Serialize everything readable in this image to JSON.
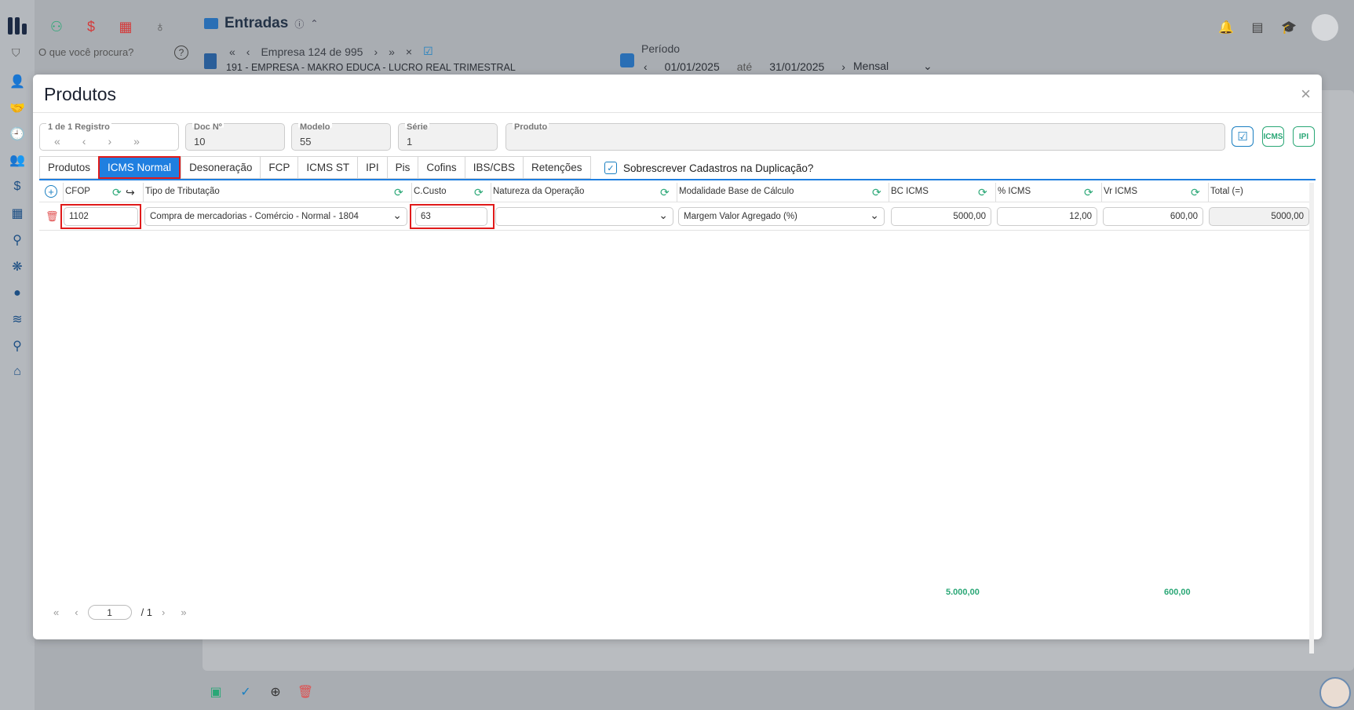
{
  "app": {
    "title": "Entradas",
    "search_placeholder": "O que você procura?",
    "empresa_nav": "Empresa 124 de 995",
    "empresa_name": "191 - EMPRESA - MAKRO EDUCA - LUCRO REAL TRIMESTRAL",
    "periodo_label": "Período",
    "date_from": "01/01/2025",
    "date_sep": "até",
    "date_to": "31/01/2025",
    "period_mode": "Mensal"
  },
  "modal": {
    "title": "Produtos",
    "close": "×",
    "record_label": "1 de 1 Registro",
    "fields": {
      "doc_label": "Doc Nº",
      "doc_value": "10",
      "modelo_label": "Modelo",
      "modelo_value": "55",
      "serie_label": "Série",
      "serie_value": "1",
      "produto_label": "Produto",
      "produto_value": ""
    },
    "actions": {
      "icms": "ICMS",
      "ipi": "IPI"
    },
    "tabs": [
      "Produtos",
      "ICMS Normal",
      "Desoneração",
      "FCP",
      "ICMS ST",
      "IPI",
      "Pis",
      "Cofins",
      "IBS/CBS",
      "Retenções"
    ],
    "override_label": "Sobrescrever Cadastros na Duplicação?",
    "columns": {
      "cfop": "CFOP",
      "tipo": "Tipo de Tributação",
      "ccusto": "C.Custo",
      "natureza": "Natureza da Operação",
      "modalidade": "Modalidade Base de Cálculo",
      "bc_icms": "BC ICMS",
      "pct_icms": "% ICMS",
      "vr_icms": "Vr ICMS",
      "total": "Total (=)"
    },
    "row": {
      "cfop": "1102",
      "tipo": "Compra de mercadorias - Comércio - Normal - 1804",
      "ccusto": "63",
      "natureza": "",
      "modalidade": "Margem Valor Agregado (%)",
      "bc_icms": "5000,00",
      "pct_icms": "12,00",
      "vr_icms": "600,00",
      "total": "5000,00"
    },
    "totals": {
      "bc_icms": "5.000,00",
      "vr_icms": "600,00"
    },
    "pager": {
      "current": "1",
      "total": "/ 1"
    }
  },
  "colors": {
    "accent": "#1f7fe0",
    "highlight": "#e01a1a",
    "green": "#2aa776"
  }
}
